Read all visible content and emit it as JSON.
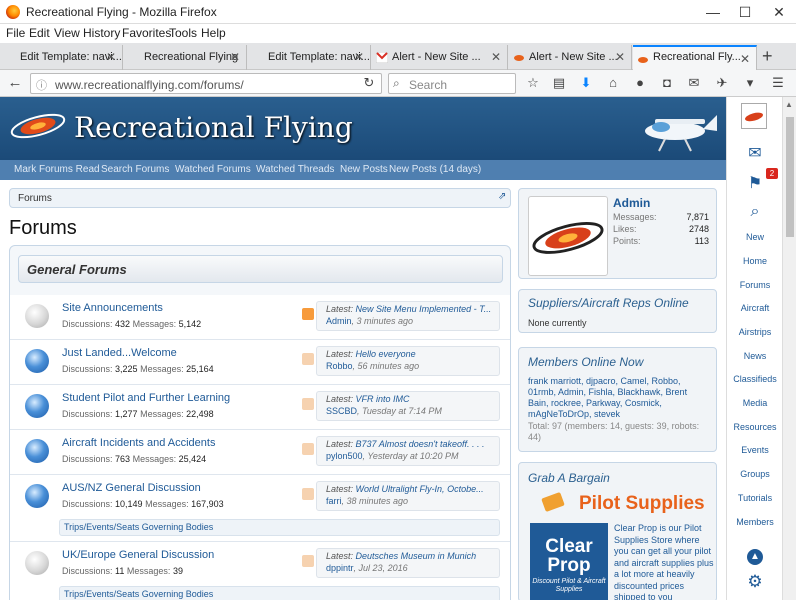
{
  "window": {
    "title": "Recreational Flying - Mozilla Firefox",
    "minimize": "—",
    "maximize": "☐",
    "close": "✕"
  },
  "menu": [
    "File",
    "Edit",
    "View",
    "History",
    "Favorites",
    "Tools",
    "Help"
  ],
  "tabs": [
    {
      "label": "Edit Template: navi..."
    },
    {
      "label": "Recreational Flying"
    },
    {
      "label": "Edit Template: navi..."
    },
    {
      "label": "Alert - New Site ..."
    },
    {
      "label": "Alert - New Site ..."
    },
    {
      "label": "Recreational Fly..."
    }
  ],
  "newtab": "+",
  "url": "www.recreationalflying.com/forums/",
  "search_placeholder": "Search",
  "site": {
    "title": "Recreational Flying"
  },
  "navtabs": [
    "Mark Forums Read",
    "Search Forums",
    "Watched Forums",
    "Watched Threads",
    "New Posts",
    "New Posts (14 days)"
  ],
  "breadcrumb": "Forums",
  "heading": "Forums",
  "section": "General Forums",
  "forums": [
    {
      "title": "Site Announcements",
      "discussions": "432",
      "messages": "5,142",
      "latest": "New Site Menu Implemented - T...",
      "user": "Admin",
      "time": "3 minutes ago",
      "icon": "grey",
      "rss": true
    },
    {
      "title": "Just Landed...Welcome",
      "discussions": "3,225",
      "messages": "25,164",
      "latest": "Hello everyone",
      "user": "Robbo",
      "time": "56 minutes ago",
      "icon": "blue",
      "rss": false
    },
    {
      "title": "Student Pilot and Further Learning",
      "discussions": "1,277",
      "messages": "22,498",
      "latest": "VFR into IMC",
      "user": "SSCBD",
      "time": "Tuesday at 7:14 PM",
      "icon": "blue",
      "rss": false
    },
    {
      "title": "Aircraft Incidents and Accidents",
      "discussions": "763",
      "messages": "25,424",
      "latest": "B737 Almost doesn't takeoff. . . .",
      "user": "pylon500",
      "time": "Yesterday at 10:20 PM",
      "icon": "blue",
      "rss": false
    },
    {
      "title": "AUS/NZ General Discussion",
      "discussions": "10,149",
      "messages": "167,903",
      "latest": "World Ultralight Fly-In, Octobe...",
      "user": "farri",
      "time": "38 minutes ago",
      "icon": "blue",
      "rss": false,
      "sub": "Trips/Events/Seats   Governing Bodies"
    },
    {
      "title": "UK/Europe General Discussion",
      "discussions": "11",
      "messages": "39",
      "latest": "Deutsches Museum in Munich",
      "user": "dppintr",
      "time": "Jul 23, 2016",
      "icon": "grey",
      "rss": false,
      "sub": "Trips/Events/Seats   Governing Bodies"
    }
  ],
  "labels": {
    "latest": "Latest:",
    "discussions": "Discussions:",
    "messages": "Messages:"
  },
  "user": {
    "name": "Admin",
    "messages_label": "Messages:",
    "messages": "7,871",
    "likes_label": "Likes:",
    "likes": "2748",
    "points_label": "Points:",
    "points": "113"
  },
  "suppliers": {
    "title": "Suppliers/Aircraft Reps Online",
    "text": "None currently"
  },
  "online": {
    "title": "Members Online Now",
    "members": "frank marriott, djpacro, Camel, Robbo, 01rmb, Admin, Fishla, Blackhawk, Brent Bain, rockree, Parkway, Cosmick, mAgNeToDrOp, stevek",
    "total": "Total: 97 (members: 14, guests: 39, robots: 44)"
  },
  "bargain": {
    "title": "Grab A Bargain",
    "brand": "Pilot Supplies",
    "logo_line1": "Clear",
    "logo_line2": "Prop",
    "logo_sub": "Discount Pilot & Aircraft Supplies",
    "text": "Clear Prop is our Pilot Supplies Store where you can get all your pilot and aircraft supplies plus a lot more at heavily discounted prices shipped to you"
  },
  "strip": {
    "badge": "2",
    "items": [
      "New",
      "Home",
      "Forums",
      "Aircraft",
      "Airstrips",
      "News",
      "Classifieds",
      "Media",
      "Resources",
      "Events",
      "Groups",
      "Tutorials",
      "Members"
    ]
  },
  "colors": {
    "banner": "#1b4a78",
    "link": "#1f5a97",
    "accent": "#0a84ff"
  }
}
